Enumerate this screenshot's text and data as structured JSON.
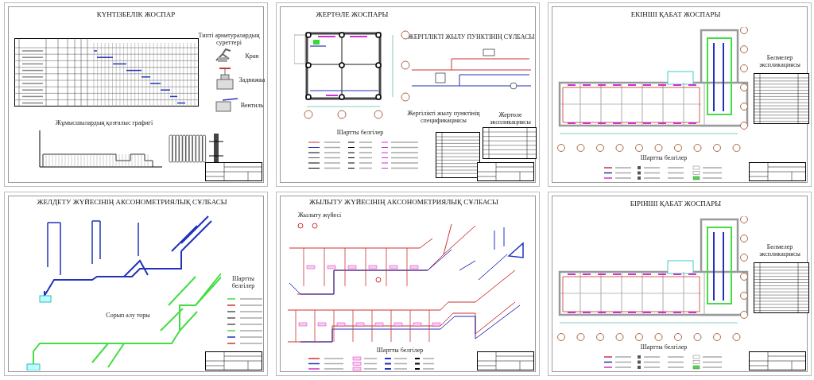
{
  "sheets": [
    {
      "kind": "schedule",
      "title": "КҮНТІЗБЕЛІК ЖОСПАР",
      "labels": [
        "Типті арматуралардың суреттері",
        "Кран",
        "Задвижка",
        "Вентиль",
        "Жұмысшылардың қозғалыс графигі"
      ]
    },
    {
      "kind": "basement",
      "title": "ЖЕРТӨЛЕ ЖОСПАРЫ",
      "labels": [
        "ЖЕРГІЛІКТІ ЖЫЛУ ПУНКТІНІҢ СҰЛБАСЫ",
        "Шартты белгілер",
        "Жергілікті жылу пунктінің спецификациясы",
        "Жертөле экспликациясы"
      ]
    },
    {
      "kind": "plan",
      "title": "ЕКІНШІ ҚАБАТ ЖОСПАРЫ",
      "labels": [
        "Бөлмелер экспликациясы",
        "Шартты белгілер"
      ]
    },
    {
      "kind": "ventilation",
      "title": "ЖЕЛДЕТУ ЖҮЙЕСІНІҢ АКСОНОМЕТРИЯЛЫҚ СҰЛБАСЫ",
      "labels": [
        "Сорып алу торы",
        "Шартты белгілер"
      ]
    },
    {
      "kind": "heating",
      "title": "ЖЫЛЫТУ ЖҮЙЕСІНІҢ АКСОНОМЕТРИЯЛЫҚ СҰЛБАСЫ",
      "labels": [
        "Жылыту жүйесі",
        "Шартты белгілер"
      ]
    },
    {
      "kind": "plan",
      "title": "БІРІНШІ ҚАБАТ ЖОСПАРЫ",
      "labels": [
        "Бөлмелер экспликациясы",
        "Шартты белгілер"
      ]
    }
  ]
}
